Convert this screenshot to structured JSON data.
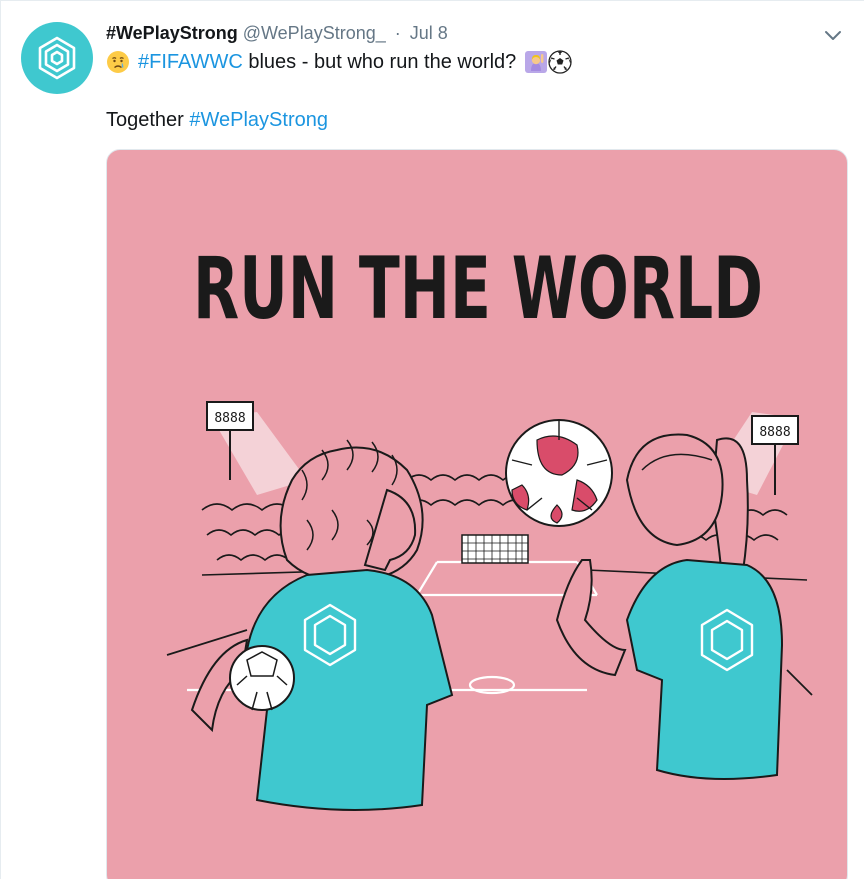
{
  "tweet": {
    "display_name": "#WePlayStrong",
    "handle": "@WePlayStrong_",
    "separator": "·",
    "time": "Jul 8",
    "line1": {
      "hashtag": "#FIFAWWC",
      "text": " blues - but who run the world?"
    },
    "line2": {
      "text": "Together ",
      "hashtag": "#WePlayStrong"
    },
    "emojis": [
      "crying-face",
      "woman-raising-hand",
      "soccer-ball"
    ],
    "icons": {
      "avatar": "hexagon-logo-icon",
      "menu": "chevron-down-icon"
    }
  },
  "media": {
    "headline": "RUN THE WORLD",
    "scoreboard_left": "8888",
    "scoreboard_right": "8888"
  },
  "colors": {
    "brand_teal": "#3fc8cf",
    "link_blue": "#1b95e0",
    "media_pink": "#eba0ab",
    "text_dark": "#14171a",
    "text_gray": "#657786"
  }
}
